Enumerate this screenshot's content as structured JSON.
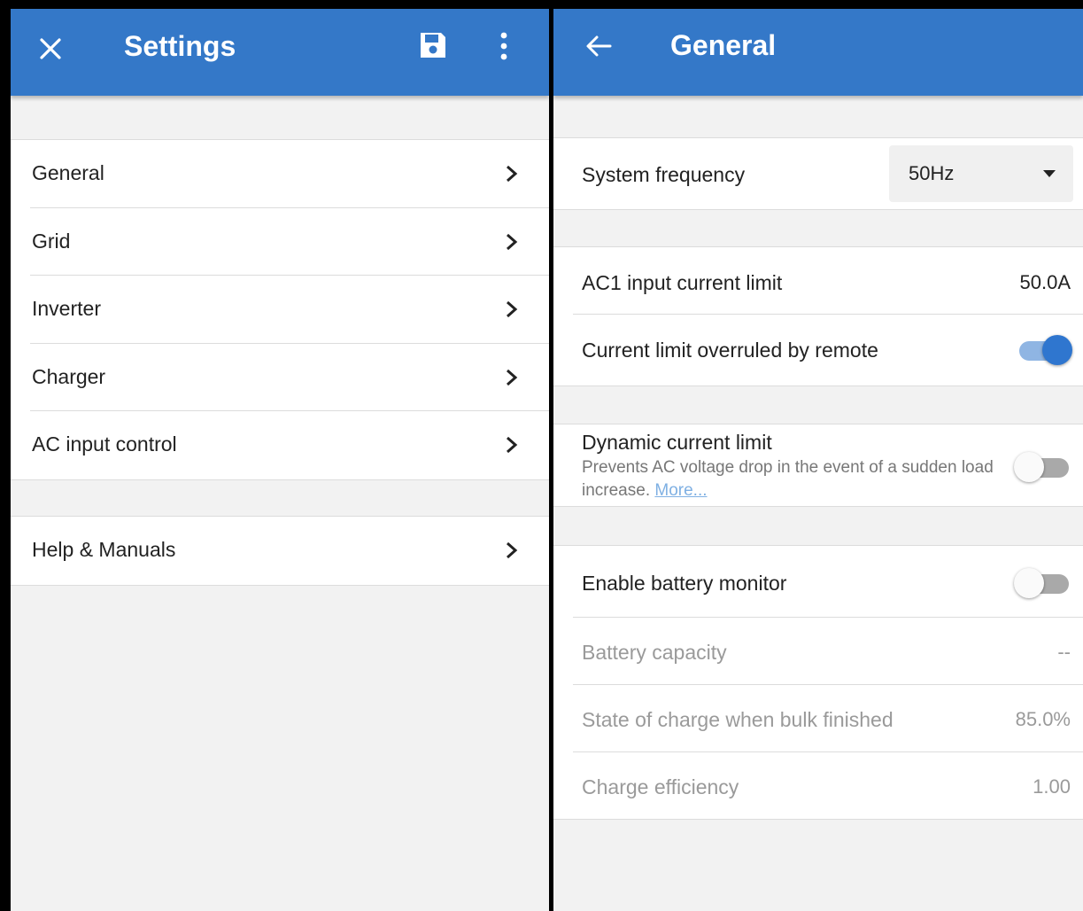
{
  "settings": {
    "title": "Settings",
    "close_icon": "close-icon",
    "save_icon": "floppy-save-icon",
    "more_icon": "more-vertical-icon",
    "menu_items": [
      {
        "label": "General"
      },
      {
        "label": "Grid"
      },
      {
        "label": "Inverter"
      },
      {
        "label": "Charger"
      },
      {
        "label": "AC input control"
      }
    ],
    "help_item": {
      "label": "Help & Manuals"
    }
  },
  "general": {
    "title": "General",
    "back_icon": "back-arrow-icon",
    "system_frequency": {
      "label": "System frequency",
      "value": "50Hz"
    },
    "ac1_input_current_limit": {
      "label": "AC1 input current limit",
      "value": "50.0A"
    },
    "current_limit_overruled": {
      "label": "Current limit overruled by remote",
      "enabled": true
    },
    "dynamic_current_limit": {
      "label": "Dynamic current limit",
      "description": "Prevents AC voltage drop in the event of a sudden load increase.",
      "more_link": "More...",
      "enabled": false
    },
    "enable_battery_monitor": {
      "label": "Enable battery monitor",
      "enabled": false
    },
    "battery_capacity": {
      "label": "Battery capacity",
      "value": "--"
    },
    "state_of_charge": {
      "label": "State of charge when bulk finished",
      "value": "85.0%"
    },
    "charge_efficiency": {
      "label": "Charge efficiency",
      "value": "1.00"
    }
  },
  "colors": {
    "app_bar": "#3478c8",
    "toggle_on": "#2f76cf",
    "background": "#f2f2f2",
    "link": "#7fb0e3"
  }
}
